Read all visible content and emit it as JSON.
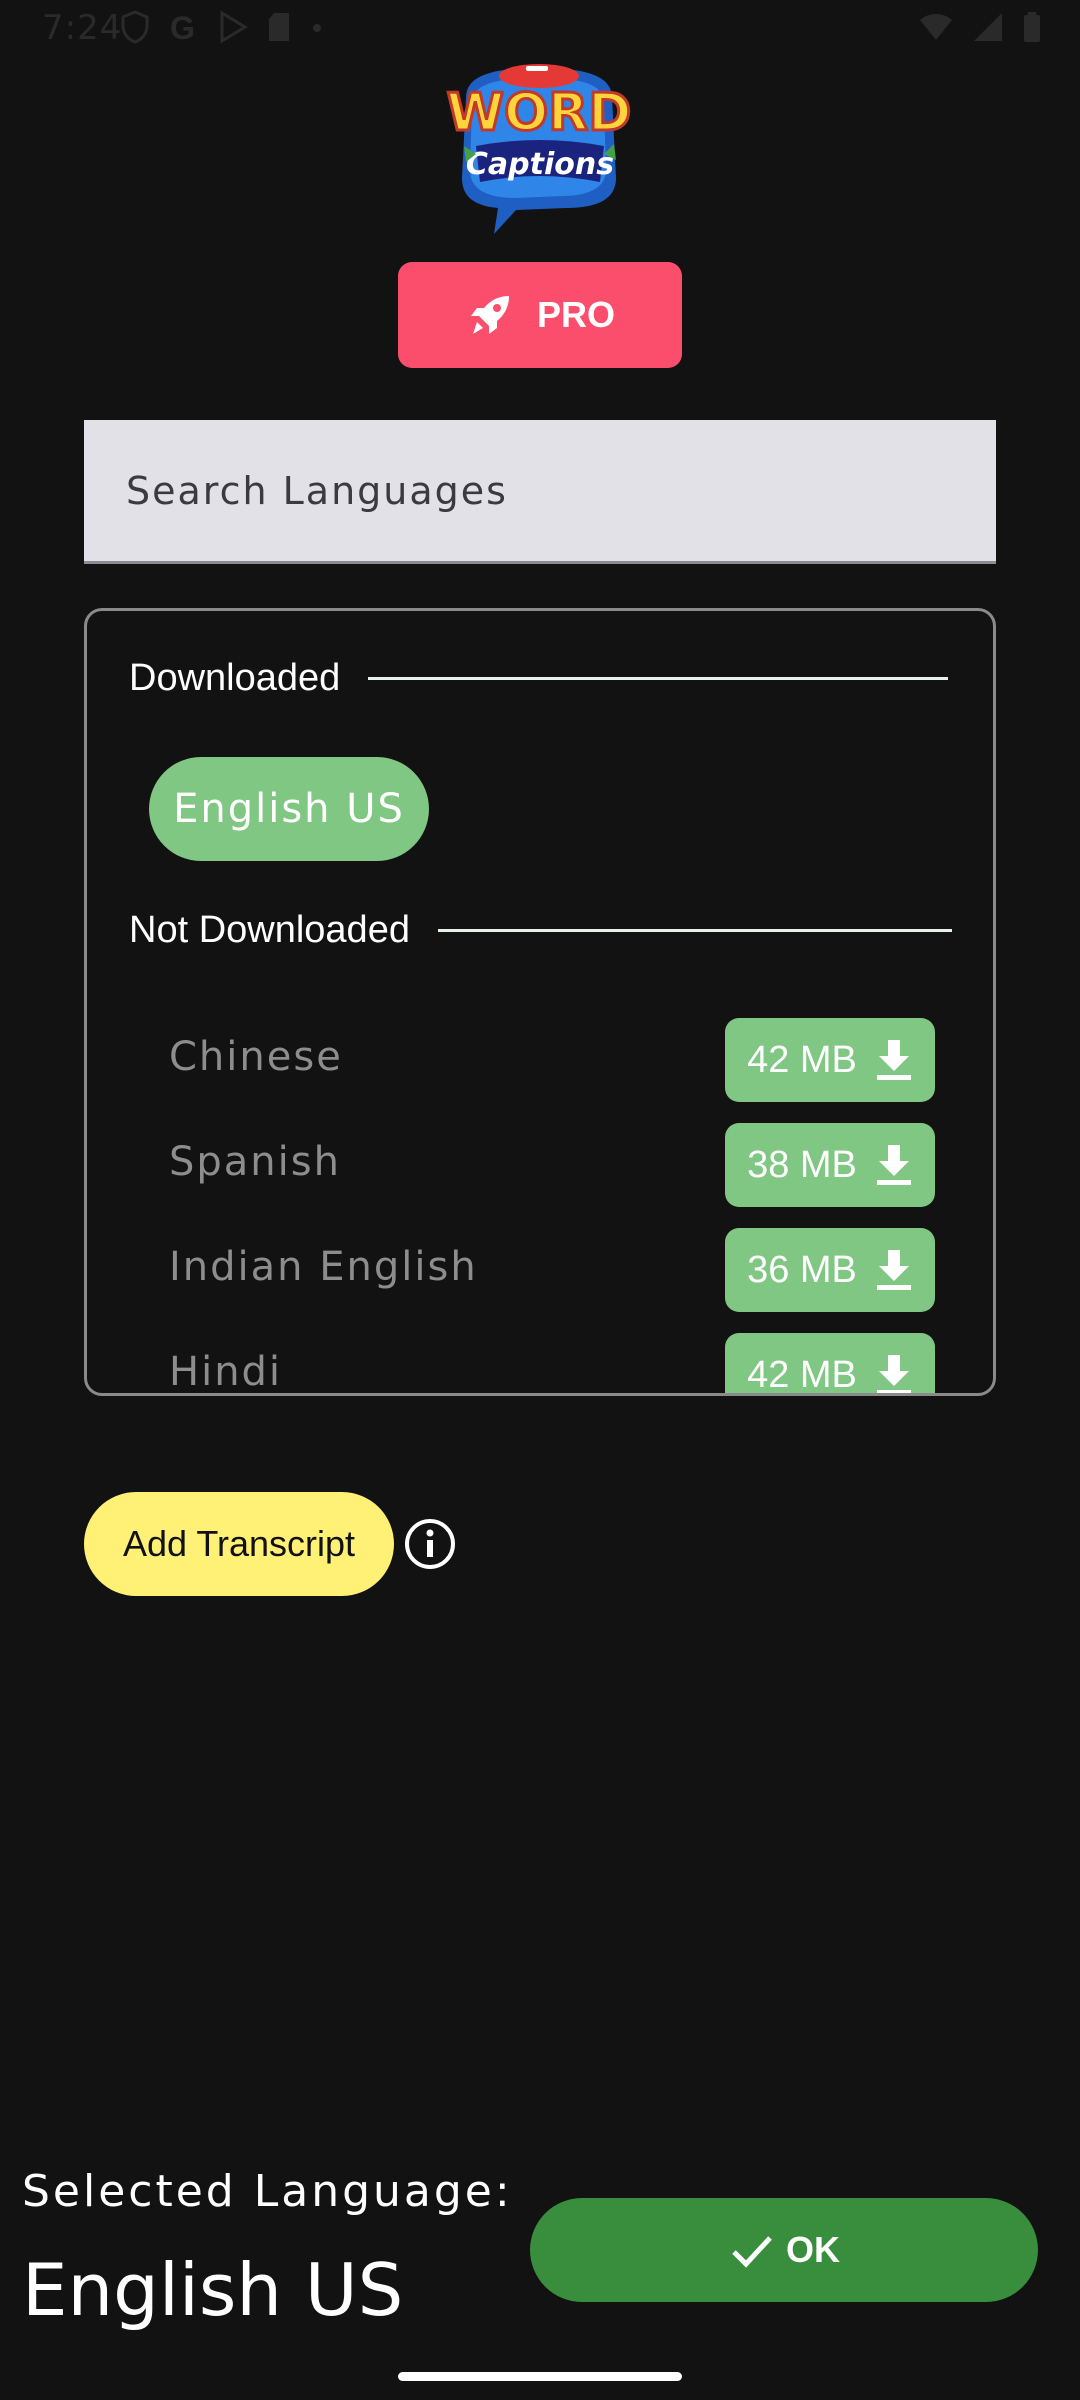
{
  "status_bar": {
    "time": "7:24",
    "left_icons": [
      "shield-icon",
      "google-icon",
      "play-store-icon",
      "sd-card-icon",
      "dot-icon"
    ],
    "right_icons": [
      "wifi-icon",
      "signal-icon",
      "battery-icon"
    ]
  },
  "logo": {
    "line1": "WORD",
    "line2": "Captions"
  },
  "pro_button": {
    "label": "PRO",
    "icon": "rocket-icon",
    "color": "#fb4e6c"
  },
  "search": {
    "placeholder": "Search Languages",
    "value": ""
  },
  "downloaded": {
    "heading": "Downloaded",
    "items": [
      {
        "label": "English US"
      }
    ]
  },
  "not_downloaded": {
    "heading": "Not Downloaded",
    "items": [
      {
        "name": "Chinese",
        "size": "42 MB"
      },
      {
        "name": "Spanish",
        "size": "38 MB"
      },
      {
        "name": "Indian English",
        "size": "36 MB"
      },
      {
        "name": "Hindi",
        "size": "42 MB"
      }
    ]
  },
  "add_transcript": {
    "label": "Add Transcript",
    "icon": "info-icon"
  },
  "selected": {
    "label": "Selected Language:",
    "value": "English US"
  },
  "ok_button": {
    "label": "OK",
    "icon": "check-icon",
    "color": "#388e3c"
  },
  "colors": {
    "background": "#121212",
    "chip_green": "#81c784",
    "transcript_yellow": "#fff176"
  }
}
